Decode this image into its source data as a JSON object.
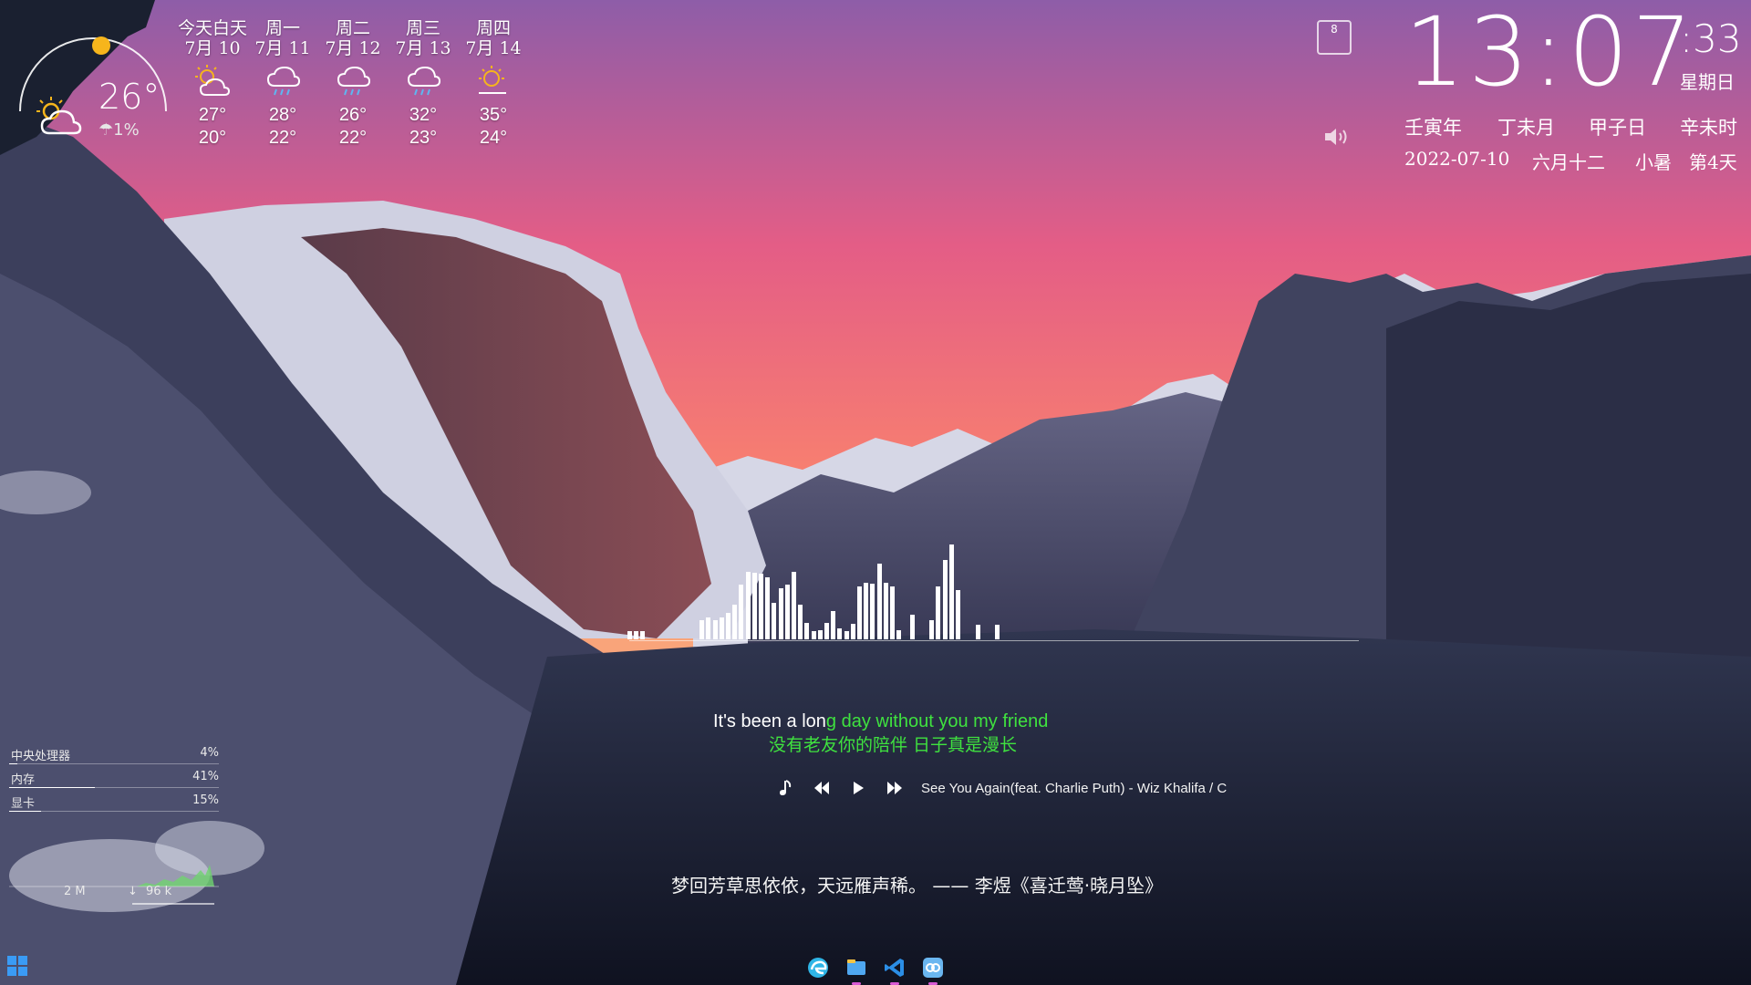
{
  "weather": {
    "current": {
      "temp": "26°",
      "rain": "1%",
      "icon": "partly-cloudy-day-icon"
    },
    "days": [
      {
        "name": "今天白天",
        "date": "7月 10",
        "icon": "partly-sunny-icon",
        "hi": "27°",
        "lo": "20°"
      },
      {
        "name": "周一",
        "date": "7月 11",
        "icon": "rain-cloud-icon",
        "hi": "28°",
        "lo": "22°"
      },
      {
        "name": "周二",
        "date": "7月 12",
        "icon": "rain-cloud-icon",
        "hi": "26°",
        "lo": "22°"
      },
      {
        "name": "周三",
        "date": "7月 13",
        "icon": "rain-cloud-icon",
        "hi": "32°",
        "lo": "23°"
      },
      {
        "name": "周四",
        "date": "7月 14",
        "icon": "partly-sunny-icon",
        "hi": "35°",
        "lo": "24°"
      }
    ]
  },
  "clock": {
    "time": "13:07",
    "seconds": ":33",
    "weekday": "星期日",
    "ganzhi": [
      "壬寅年",
      "丁未月",
      "甲子日",
      "辛未时"
    ],
    "date": "2022-07-10",
    "lunar": "六月十二",
    "solar_term": "小暑",
    "term_day": "第4天",
    "calendar_day": "8"
  },
  "music": {
    "lyric_sung": "It's been a lon",
    "lyric_unsung": "g day without you my friend",
    "lyric_cn": "没有老友你的陪伴 日子真是漫长",
    "song": "See You Again(feat. Charlie Puth) - Wiz Khalifa / C",
    "spectrum": [
      0.09,
      0.09,
      0.09,
      0,
      0,
      0,
      0,
      0,
      0,
      0,
      0,
      0.2,
      0.23,
      0.2,
      0.23,
      0.28,
      0.37,
      0.58,
      0.71,
      0.7,
      0.69,
      0.65,
      0.38,
      0.54,
      0.58,
      0.71,
      0.37,
      0.17,
      0.09,
      0.1,
      0.17,
      0.3,
      0.12,
      0.09,
      0.16,
      0.56,
      0.6,
      0.59,
      0.8,
      0.6,
      0.56,
      0.1,
      0,
      0.26,
      0,
      0,
      0.2,
      0.56,
      0.84,
      1.0,
      0.52,
      0,
      0,
      0.15,
      0,
      0,
      0.15
    ]
  },
  "quote": "梦回芳草思依依，天远雁声稀。 —— 李煜《喜迁莺·晓月坠》",
  "sysmon": {
    "rows": [
      {
        "label": "中央处理器",
        "value": "4%",
        "pct": 4
      },
      {
        "label": "内存",
        "value": "41%",
        "pct": 41
      },
      {
        "label": "显卡",
        "value": "15%",
        "pct": 15
      }
    ],
    "net_up": "2 M",
    "net_down": "96 k"
  },
  "taskbar": {
    "apps": [
      {
        "name": "edge-icon",
        "color": "#2fb5e6"
      },
      {
        "name": "file-explorer-icon",
        "color": "#4fa7f0"
      },
      {
        "name": "vscode-icon",
        "color": "#2b8ee6"
      },
      {
        "name": "app-icon",
        "color": "#6ab6f0"
      }
    ]
  },
  "colors": {
    "lyric_highlight": "#3fe23f",
    "sun": "#f6b51c"
  }
}
